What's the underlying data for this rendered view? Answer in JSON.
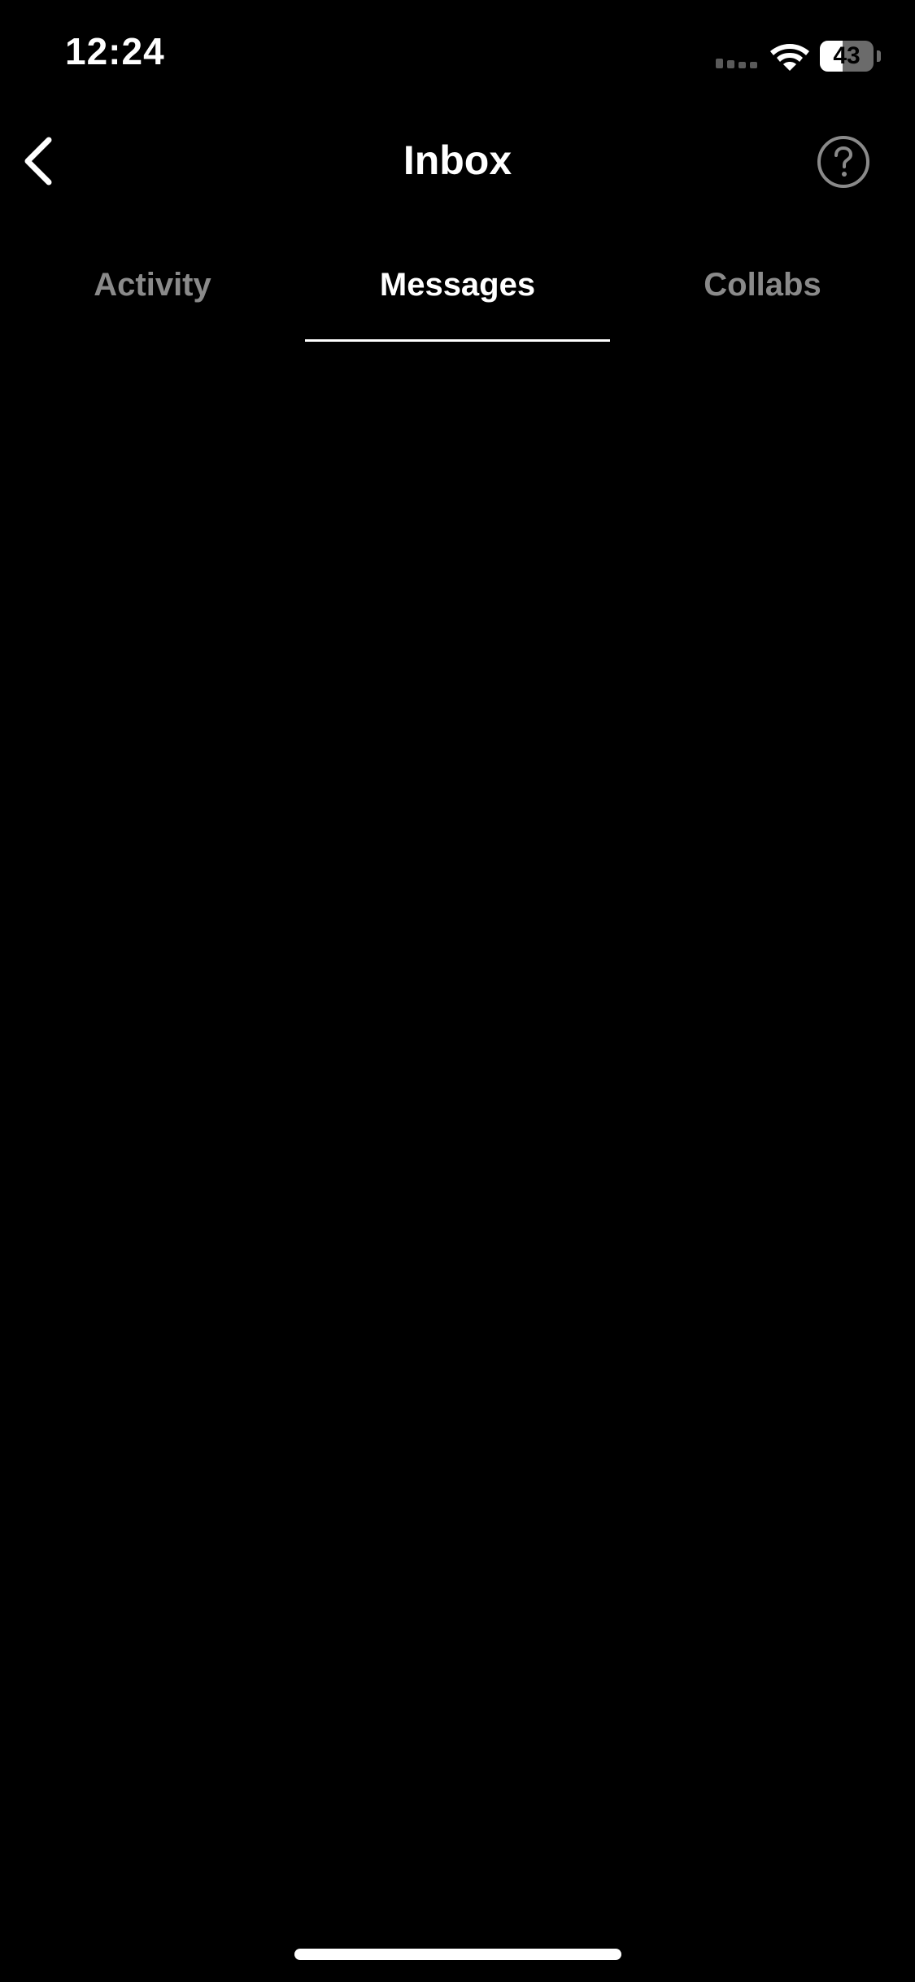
{
  "status_bar": {
    "time": "12:24",
    "battery_level": "43",
    "battery_fraction": 0.43,
    "icons": [
      "signal-icon",
      "wifi-icon",
      "battery-icon"
    ]
  },
  "header": {
    "title": "Inbox",
    "back_icon": "chevron-left-icon",
    "help_icon": "question-circle-icon"
  },
  "tabs": [
    {
      "label": "Activity",
      "active": false
    },
    {
      "label": "Messages",
      "active": true
    },
    {
      "label": "Collabs",
      "active": false
    }
  ],
  "colors": {
    "background": "#000000",
    "text_primary": "#ffffff",
    "text_inactive": "#8a8a8a"
  }
}
